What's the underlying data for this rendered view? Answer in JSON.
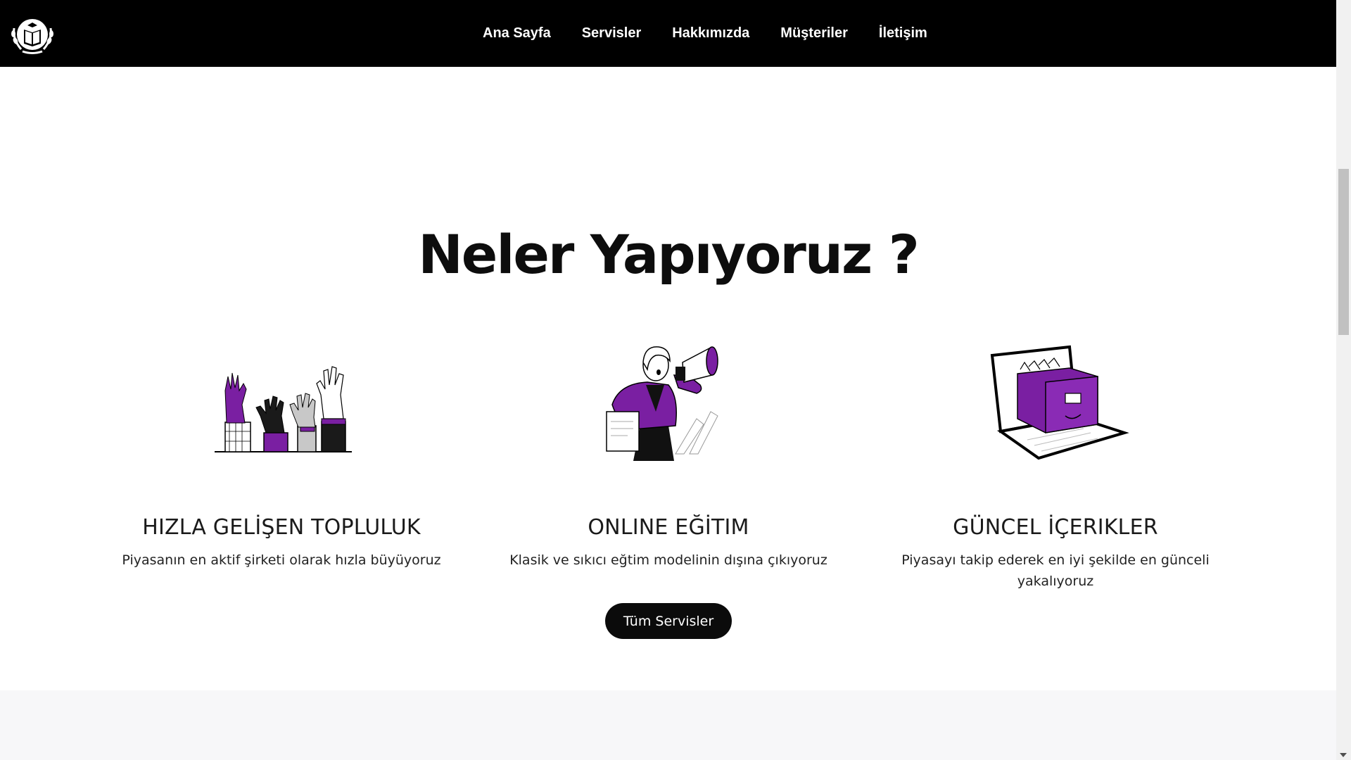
{
  "nav": {
    "items": [
      {
        "label": "Ana Sayfa"
      },
      {
        "label": "Servisler"
      },
      {
        "label": "Hakkımızda"
      },
      {
        "label": "Müşteriler"
      },
      {
        "label": "İletişim"
      }
    ]
  },
  "main": {
    "title": "Neler Yapıyoruz ?",
    "cards": [
      {
        "title": "HIZLA GELİŞEN TOPLULUK",
        "text": "Piyasanın en aktif şirketi olarak hızla büyüyoruz",
        "icon": "raised-hands-icon"
      },
      {
        "title": "ONLINE EĞİTIM",
        "text": "Klasik ve sıkıcı eğtim modelinin dışına çıkıyoruz",
        "icon": "megaphone-woman-icon"
      },
      {
        "title": "GÜNCEL İÇERIKLER",
        "text": "Piyasayı takip ederek en iyi şekilde en günceli yakalıyoruz",
        "icon": "laptop-file-drawer-icon"
      }
    ],
    "all_services_label": "Tüm Servisler"
  },
  "colors": {
    "accent": "#7a1fa2",
    "nav_bg": "#000000",
    "button_bg": "#0b0b0b"
  }
}
